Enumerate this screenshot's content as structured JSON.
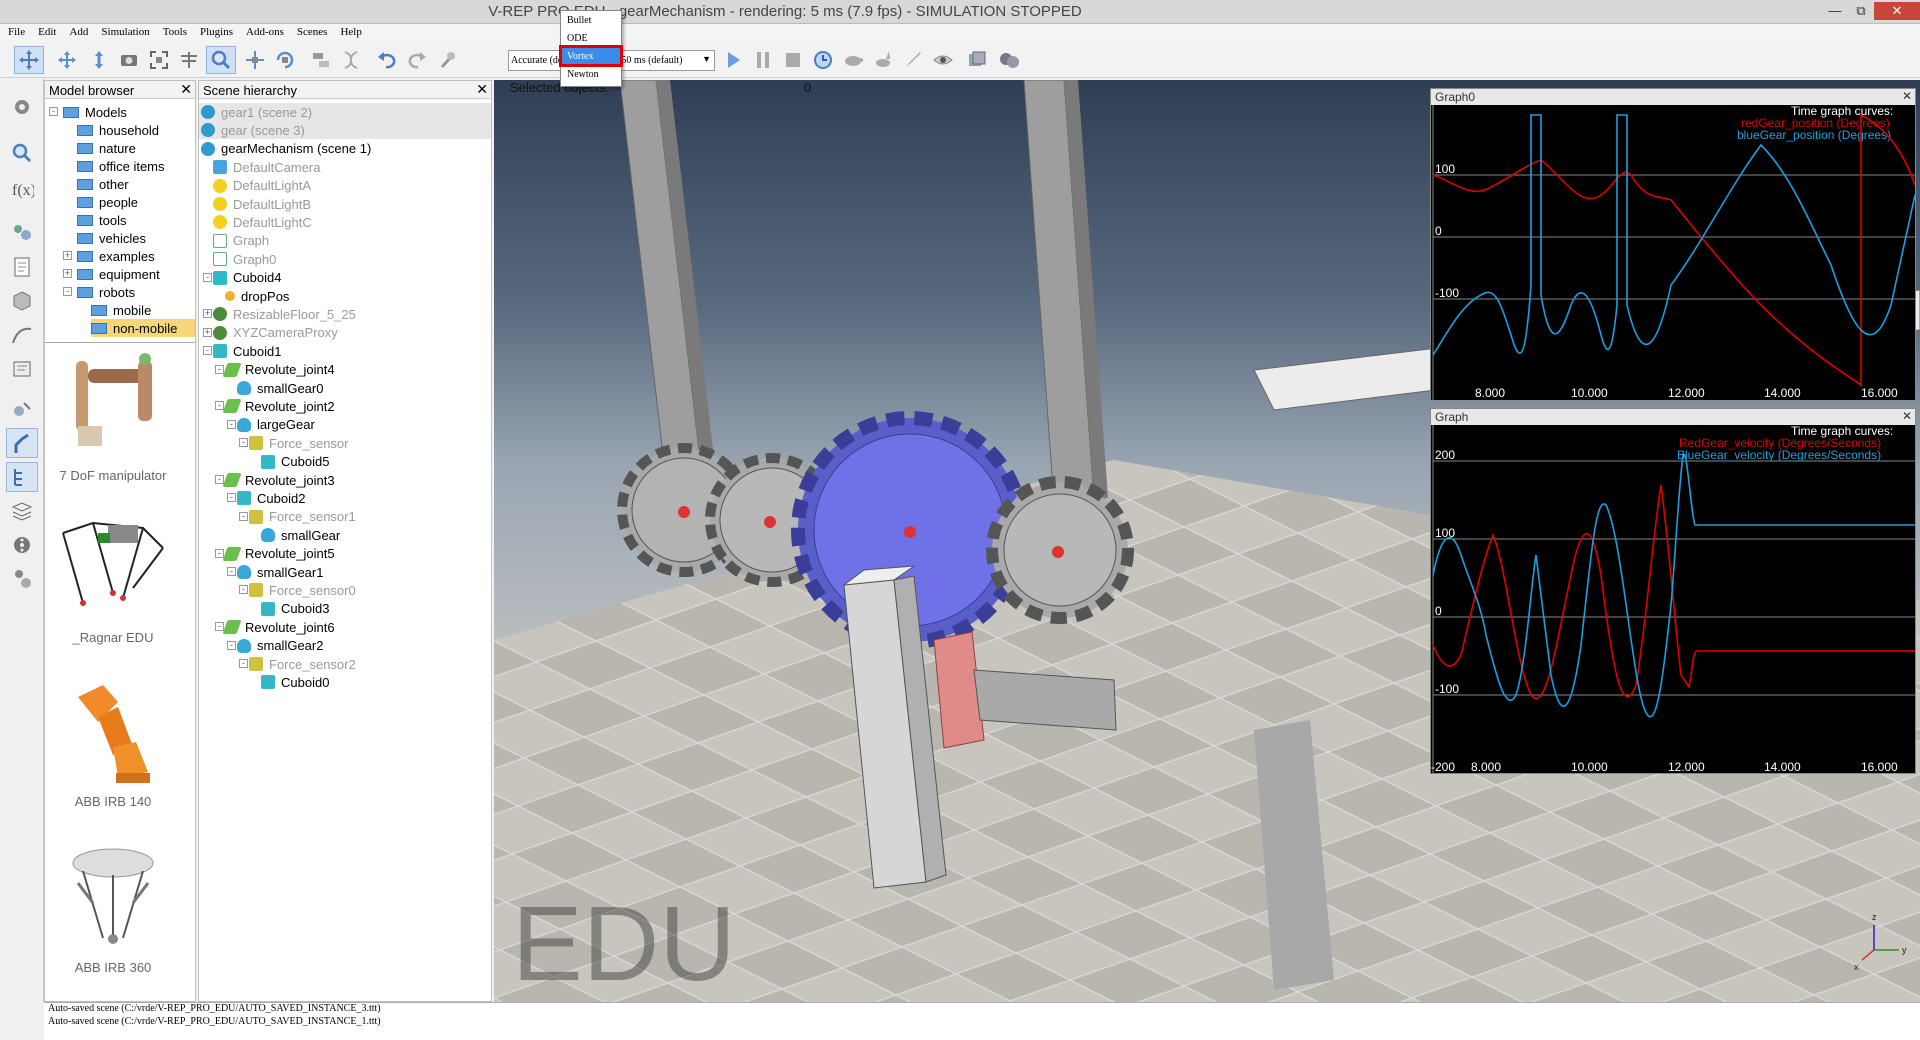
{
  "window": {
    "title": "V-REP PRO EDU - gearMechanism - rendering: 5 ms (7.9 fps) - SIMULATION STOPPED",
    "minimize": "—",
    "maximize": "⧉",
    "close": "✕"
  },
  "menu": [
    "File",
    "Edit",
    "Add",
    "Simulation",
    "Tools",
    "Plugins",
    "Add-ons",
    "Scenes",
    "Help"
  ],
  "toolbar": {
    "engine_options": [
      "Bullet",
      "ODE",
      "Vortex",
      "Newton"
    ],
    "engine_selected": "Vortex",
    "accuracy": "Accurate (default)",
    "timestep": "dt=50 ms (default)"
  },
  "model_browser": {
    "title": "Model browser",
    "tree": [
      {
        "label": "Models",
        "indent": 0,
        "exp": "-"
      },
      {
        "label": "household",
        "indent": 1,
        "exp": ""
      },
      {
        "label": "nature",
        "indent": 1,
        "exp": ""
      },
      {
        "label": "office items",
        "indent": 1,
        "exp": ""
      },
      {
        "label": "other",
        "indent": 1,
        "exp": ""
      },
      {
        "label": "people",
        "indent": 1,
        "exp": ""
      },
      {
        "label": "tools",
        "indent": 1,
        "exp": ""
      },
      {
        "label": "vehicles",
        "indent": 1,
        "exp": ""
      },
      {
        "label": "examples",
        "indent": 1,
        "exp": "+"
      },
      {
        "label": "equipment",
        "indent": 1,
        "exp": "+"
      },
      {
        "label": "robots",
        "indent": 1,
        "exp": "-"
      },
      {
        "label": "mobile",
        "indent": 2,
        "exp": ""
      },
      {
        "label": "non-mobile",
        "indent": 2,
        "exp": ""
      }
    ],
    "thumbnails": [
      "7 DoF manipulator",
      "_Ragnar EDU",
      "ABB IRB 140",
      "ABB IRB 360"
    ]
  },
  "scene_hierarchy": {
    "title": "Scene hierarchy",
    "rows": [
      {
        "label": "gear1 (scene 2)",
        "indent": 0,
        "icon": "scene",
        "dim": true,
        "exp": "",
        "sel": true
      },
      {
        "label": "gear (scene 3)",
        "indent": 0,
        "icon": "scene",
        "dim": true,
        "exp": "",
        "sel": true
      },
      {
        "label": "gearMechanism (scene 1)",
        "indent": 0,
        "icon": "scene",
        "dim": false,
        "exp": ""
      },
      {
        "label": "DefaultCamera",
        "indent": 1,
        "icon": "camera",
        "dim": true,
        "exp": ""
      },
      {
        "label": "DefaultLightA",
        "indent": 1,
        "icon": "light",
        "dim": true,
        "exp": ""
      },
      {
        "label": "DefaultLightB",
        "indent": 1,
        "icon": "light",
        "dim": true,
        "exp": ""
      },
      {
        "label": "DefaultLightC",
        "indent": 1,
        "icon": "light",
        "dim": true,
        "exp": ""
      },
      {
        "label": "Graph",
        "indent": 1,
        "icon": "graph",
        "dim": true,
        "exp": ""
      },
      {
        "label": "Graph0",
        "indent": 1,
        "icon": "graph",
        "dim": true,
        "exp": ""
      },
      {
        "label": "Cuboid4",
        "indent": 1,
        "icon": "cube",
        "dim": false,
        "exp": "-"
      },
      {
        "label": "dropPos",
        "indent": 2,
        "icon": "dummy",
        "dim": false,
        "exp": ""
      },
      {
        "label": "ResizableFloor_5_25",
        "indent": 1,
        "icon": "model",
        "dim": true,
        "exp": "+"
      },
      {
        "label": "XYZCameraProxy",
        "indent": 1,
        "icon": "model",
        "dim": true,
        "exp": "+"
      },
      {
        "label": "Cuboid1",
        "indent": 1,
        "icon": "cube",
        "dim": false,
        "exp": "-"
      },
      {
        "label": "Revolute_joint4",
        "indent": 2,
        "icon": "joint",
        "dim": false,
        "exp": "-"
      },
      {
        "label": "smallGear0",
        "indent": 3,
        "icon": "shape",
        "dim": false,
        "exp": ""
      },
      {
        "label": "Revolute_joint2",
        "indent": 2,
        "icon": "joint",
        "dim": false,
        "exp": "-"
      },
      {
        "label": "largeGear",
        "indent": 3,
        "icon": "shape",
        "dim": false,
        "exp": "-"
      },
      {
        "label": "Force_sensor",
        "indent": 4,
        "icon": "force",
        "dim": true,
        "exp": "-"
      },
      {
        "label": "Cuboid5",
        "indent": 5,
        "icon": "cube",
        "dim": false,
        "exp": ""
      },
      {
        "label": "Revolute_joint3",
        "indent": 2,
        "icon": "joint",
        "dim": false,
        "exp": "-"
      },
      {
        "label": "Cuboid2",
        "indent": 3,
        "icon": "cube",
        "dim": false,
        "exp": "-"
      },
      {
        "label": "Force_sensor1",
        "indent": 4,
        "icon": "force",
        "dim": true,
        "exp": "-"
      },
      {
        "label": "smallGear",
        "indent": 5,
        "icon": "shape",
        "dim": false,
        "exp": ""
      },
      {
        "label": "Revolute_joint5",
        "indent": 2,
        "icon": "joint",
        "dim": false,
        "exp": "-"
      },
      {
        "label": "smallGear1",
        "indent": 3,
        "icon": "shape",
        "dim": false,
        "exp": "-"
      },
      {
        "label": "Force_sensor0",
        "indent": 4,
        "icon": "force",
        "dim": true,
        "exp": "-"
      },
      {
        "label": "Cuboid3",
        "indent": 5,
        "icon": "cube",
        "dim": false,
        "exp": ""
      },
      {
        "label": "Revolute_joint6",
        "indent": 2,
        "icon": "joint",
        "dim": false,
        "exp": "-"
      },
      {
        "label": "smallGear2",
        "indent": 3,
        "icon": "shape",
        "dim": false,
        "exp": "-"
      },
      {
        "label": "Force_sensor2",
        "indent": 4,
        "icon": "force",
        "dim": true,
        "exp": "-"
      },
      {
        "label": "Cuboid0",
        "indent": 5,
        "icon": "cube",
        "dim": false,
        "exp": ""
      }
    ]
  },
  "viewport": {
    "selected_label": "Selected objects:",
    "selected_count": "0",
    "watermark": "EDU",
    "axis_labels": {
      "z": "z",
      "y": "y",
      "x": "x"
    }
  },
  "graphs": [
    {
      "title": "Graph0",
      "legend_title": "Time graph curves:",
      "curves": [
        {
          "name": "redGear_position (Degrees)",
          "color": "#e00000"
        },
        {
          "name": "blueGear_position (Degrees)",
          "color": "#1aa0e0"
        }
      ],
      "y_ticks": [
        "100",
        "0",
        "-100"
      ],
      "x_ticks": [
        "8.000",
        "10.000",
        "12.000",
        "14.000",
        "16.000"
      ]
    },
    {
      "title": "Graph",
      "legend_title": "Time graph curves:",
      "curves": [
        {
          "name": "RedGear_velocity (Degrees/Seconds)",
          "color": "#e00000"
        },
        {
          "name": "BlueGear_velocity (Degrees/Seconds)",
          "color": "#1aa0e0"
        }
      ],
      "y_ticks": [
        "200",
        "100",
        "0",
        "-100",
        "-200"
      ],
      "x_ticks": [
        "8.000",
        "10.000",
        "12.000",
        "14.000",
        "16.000"
      ]
    }
  ],
  "status": [
    "Auto-saved scene (C:/vrde/V-REP_PRO_EDU/AUTO_SAVED_INSTANCE_3.ttt)",
    "Auto-saved scene (C:/vrde/V-REP_PRO_EDU/AUTO_SAVED_INSTANCE_1.ttt)"
  ],
  "colors": {
    "gear_blue": "#6e72e6",
    "gear_red": "#e08a8a",
    "gear_gray": "#a9a9a9",
    "graph_bg": "#000000"
  }
}
